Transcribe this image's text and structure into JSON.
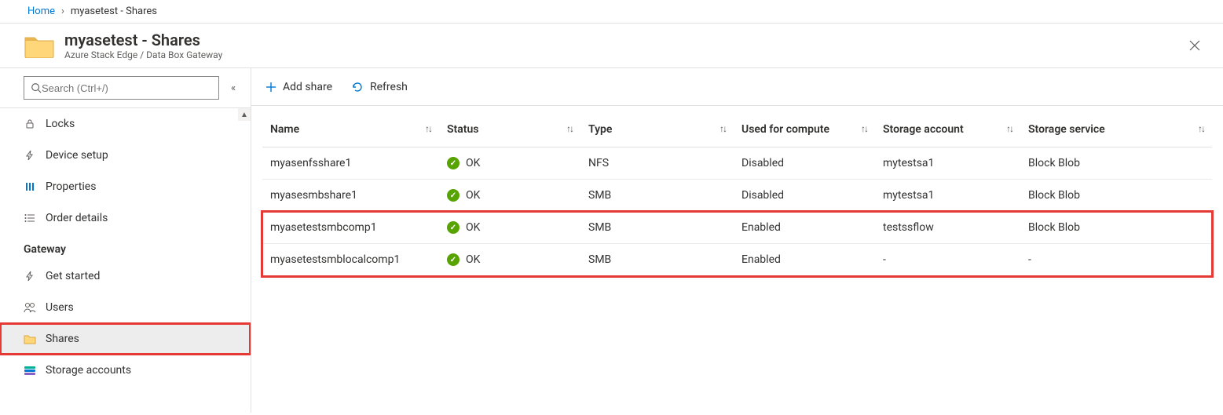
{
  "breadcrumb": {
    "home": "Home",
    "current": "myasetest - Shares"
  },
  "header": {
    "title": "myasetest - Shares",
    "subtitle": "Azure Stack Edge / Data Box Gateway"
  },
  "search": {
    "placeholder": "Search (Ctrl+/)"
  },
  "sidebar": {
    "items": [
      {
        "icon": "lock-icon",
        "label": "Locks"
      },
      {
        "icon": "bolt-icon",
        "label": "Device setup"
      },
      {
        "icon": "sliders-icon",
        "label": "Properties"
      },
      {
        "icon": "list-icon",
        "label": "Order details"
      }
    ],
    "section": "Gateway",
    "gateway_items": [
      {
        "icon": "bolt-icon",
        "label": "Get started"
      },
      {
        "icon": "users-icon",
        "label": "Users"
      },
      {
        "icon": "folder-icon",
        "label": "Shares",
        "active": true
      },
      {
        "icon": "storage-icon",
        "label": "Storage accounts"
      }
    ]
  },
  "toolbar": {
    "add": "Add share",
    "refresh": "Refresh"
  },
  "table": {
    "headers": {
      "name": "Name",
      "status": "Status",
      "type": "Type",
      "compute": "Used for compute",
      "account": "Storage account",
      "service": "Storage service"
    },
    "rows": [
      {
        "name": "myasenfsshare1",
        "status": "OK",
        "type": "NFS",
        "compute": "Disabled",
        "account": "mytestsa1",
        "service": "Block Blob"
      },
      {
        "name": "myasesmbshare1",
        "status": "OK",
        "type": "SMB",
        "compute": "Disabled",
        "account": "mytestsa1",
        "service": "Block Blob"
      },
      {
        "name": "myasetestsmbcomp1",
        "status": "OK",
        "type": "SMB",
        "compute": "Enabled",
        "account": "testssflow",
        "service": "Block Blob"
      },
      {
        "name": "myasetestsmblocalcomp1",
        "status": "OK",
        "type": "SMB",
        "compute": "Enabled",
        "account": "-",
        "service": "-"
      }
    ]
  }
}
